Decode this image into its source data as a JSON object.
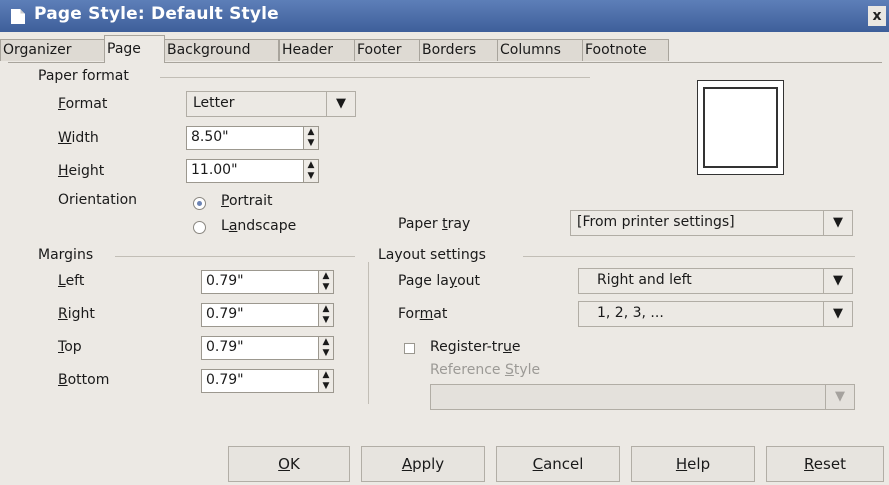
{
  "window": {
    "title": "Page Style: Default Style",
    "close_glyph": "x"
  },
  "tabs": [
    "Organizer",
    "Page",
    "Background",
    "Header",
    "Footer",
    "Borders",
    "Columns",
    "Footnote"
  ],
  "active_tab": "Page",
  "paper_format": {
    "section": "Paper format",
    "format_label": "Format",
    "format_value": "Letter",
    "width_label": "Width",
    "width_value": "8.50\"",
    "height_label": "Height",
    "height_value": "11.00\"",
    "orientation_label": "Orientation",
    "portrait": "Portrait",
    "landscape": "Landscape",
    "selected": "Portrait",
    "paper_tray_label": "Paper tray",
    "paper_tray_value": "[From printer settings]"
  },
  "margins": {
    "section": "Margins",
    "left_label": "Left",
    "left_value": "0.79\"",
    "right_label": "Right",
    "right_value": "0.79\"",
    "top_label": "Top",
    "top_value": "0.79\"",
    "bottom_label": "Bottom",
    "bottom_value": "0.79\""
  },
  "layout_settings": {
    "section": "Layout settings",
    "page_layout_label": "Page layout",
    "page_layout_value": "Right and left",
    "format_label": "Format",
    "format_value": "1, 2, 3, ...",
    "register_true_label": "Register-true",
    "register_true_checked": false,
    "reference_style_label": "Reference Style",
    "reference_style_value": ""
  },
  "buttons": {
    "ok": "OK",
    "apply": "Apply",
    "cancel": "Cancel",
    "help": "Help",
    "reset": "Reset"
  },
  "colors": {
    "titlebar": "#4a6ba8",
    "dialog_bg": "#ece9e4",
    "radio_dot": "#6d84b4"
  },
  "icons": [
    "document-icon",
    "close-icon",
    "dropdown-arrow-icon",
    "spin-arrows-icon"
  ]
}
